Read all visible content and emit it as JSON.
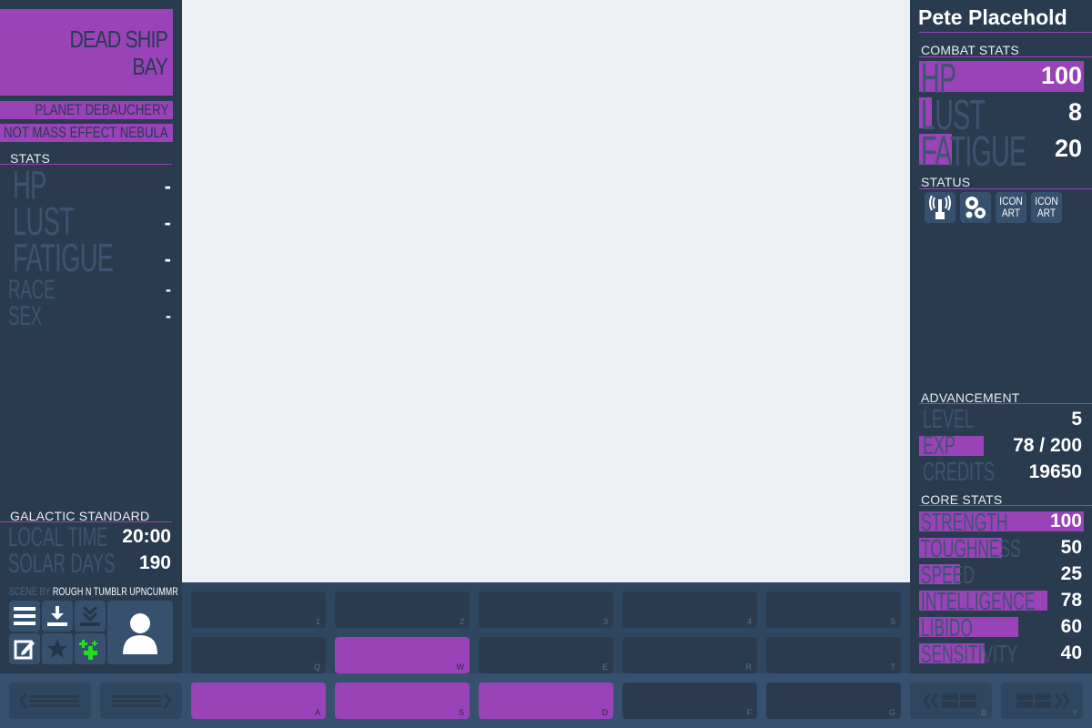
{
  "location": {
    "room": "DEAD SHIP BAY",
    "planet": "PLANET DEBAUCHERY",
    "system": "NOT MASS EFFECT NEBULA"
  },
  "enemy_stats": {
    "header": "STATS",
    "hp_label": "HP",
    "hp_value": "-",
    "lust_label": "LUST",
    "lust_value": "-",
    "fatigue_label": "FATIGUE",
    "fatigue_value": "-",
    "race_label": "RACE",
    "race_value": "-",
    "sex_label": "SEX",
    "sex_value": "-"
  },
  "time": {
    "header": "GALACTIC STANDARD",
    "local_label": "LOCAL TIME",
    "local_value": "20:00",
    "days_label": "SOLAR DAYS",
    "days_value": "190"
  },
  "credit": {
    "prefix": "SCENE BY",
    "author": "ROUGH N TUMBLR UPNCUMMR"
  },
  "menu_icons": [
    "menu-icon",
    "save-icon",
    "load-icon",
    "edit-icon",
    "star-icon",
    "level-up-icon",
    "character-icon"
  ],
  "player": {
    "name": "Pete Placehold",
    "combat_header": "COMBAT STATS",
    "hp_label": "HP",
    "hp_value": "100",
    "hp_fill": 1.0,
    "lust_label": "LUST",
    "lust_value": "8",
    "lust_fill": 0.08,
    "fatigue_label": "FATIGUE",
    "fatigue_value": "20",
    "fatigue_fill": 0.2,
    "status_header": "STATUS",
    "status_icons": [
      {
        "name": "radio-signal-icon",
        "text": ""
      },
      {
        "name": "bubbles-icon",
        "text": ""
      },
      {
        "name": "placeholder-icon",
        "text": "ICON ART"
      },
      {
        "name": "placeholder-icon",
        "text": "ICON ART"
      }
    ],
    "advancement_header": "ADVANCEMENT",
    "level_label": "LEVEL",
    "level_value": "5",
    "exp_label": "EXP",
    "exp_value": "78 / 200",
    "exp_fill": 0.39,
    "credits_label": "CREDITS",
    "credits_value": "19650",
    "core_header": "CORE STATS",
    "core": [
      {
        "label": "STRENGTH",
        "value": "100",
        "fill": 1.0
      },
      {
        "label": "TOUGHNESS",
        "value": "50",
        "fill": 0.5
      },
      {
        "label": "SPEED",
        "value": "25",
        "fill": 0.25
      },
      {
        "label": "INTELLIGENCE",
        "value": "78",
        "fill": 0.78
      },
      {
        "label": "LIBIDO",
        "value": "60",
        "fill": 0.6
      },
      {
        "label": "SENSITIVITY",
        "value": "40",
        "fill": 0.4
      }
    ]
  },
  "buttons": {
    "row1_keys": [
      "1",
      "2",
      "3",
      "4",
      "5"
    ],
    "row2_keys": [
      "Q",
      "W",
      "E",
      "R",
      "T"
    ],
    "row3_keys": [
      "A",
      "S",
      "D",
      "F",
      "G"
    ],
    "nav_left_key": "B",
    "nav_right_key": "Y"
  }
}
